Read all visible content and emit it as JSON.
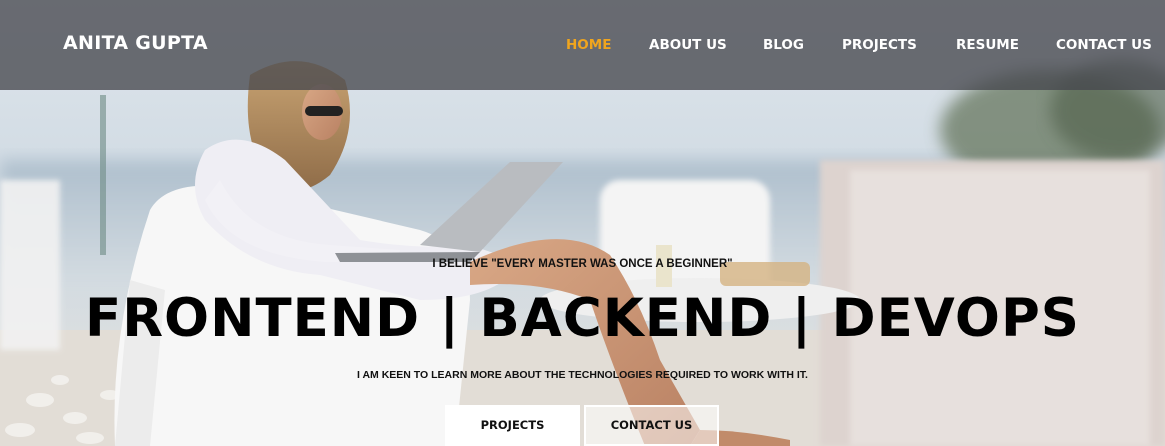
{
  "brand": {
    "name": "ANITA GUPTA"
  },
  "nav": {
    "items": [
      {
        "label": "HOME",
        "active": true
      },
      {
        "label": "ABOUT US",
        "active": false
      },
      {
        "label": "BLOG",
        "active": false
      },
      {
        "label": "PROJECTS",
        "active": false
      },
      {
        "label": "RESUME",
        "active": false
      },
      {
        "label": "CONTACT US",
        "active": false
      }
    ]
  },
  "hero": {
    "quote": "I BELIEVE \"EVERY MASTER WAS ONCE A BEGINNER\"",
    "headline": "FRONTEND | BACKEND | DEVOPS",
    "subline": "I AM KEEN TO LEARN MORE ABOUT THE TECHNOLOGIES REQUIRED TO WORK WITH IT.",
    "buttons": {
      "projects": "PROJECTS",
      "contact": "CONTACT US"
    }
  },
  "colors": {
    "accent": "#f0a51e",
    "navbar_bg": "#46484e",
    "text_dark": "#000000",
    "text_light": "#ffffff"
  }
}
